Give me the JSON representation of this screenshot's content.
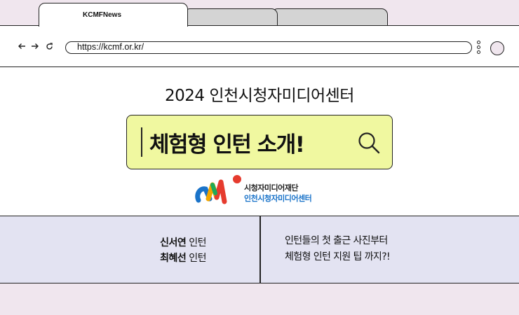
{
  "browser": {
    "tabs": [
      {
        "label": "KCMFNews",
        "active": true
      },
      {
        "label": "",
        "active": false
      },
      {
        "label": "",
        "active": false
      }
    ],
    "nav": {
      "back_icon": "arrow-left-icon",
      "forward_icon": "arrow-right-icon",
      "reload_icon": "reload-icon"
    },
    "url": "https://kcmf.or.kr/",
    "menu_icon": "kebab-menu-icon",
    "profile_icon": "profile-circle-icon"
  },
  "main": {
    "headline": "2024 인천시청자미디어센터",
    "search_text": "체험형 인턴 소개!",
    "search_icon": "search-icon",
    "search_bg": "#f0f8a0",
    "logo": {
      "line1": "시청자미디어재단",
      "line2": "인천시청자미디어센터"
    }
  },
  "info": {
    "interns": [
      {
        "name": "신서연",
        "role": "인턴"
      },
      {
        "name": "최혜선",
        "role": "인턴"
      }
    ],
    "description": [
      "인턴들의 첫 출근 사진부터",
      "체험형 인턴 지원 팁 까지?!"
    ]
  },
  "colors": {
    "page_bg": "#f0e6ee",
    "band_bg": "#e3e3f2",
    "logo_blue": "#1a73c9"
  }
}
